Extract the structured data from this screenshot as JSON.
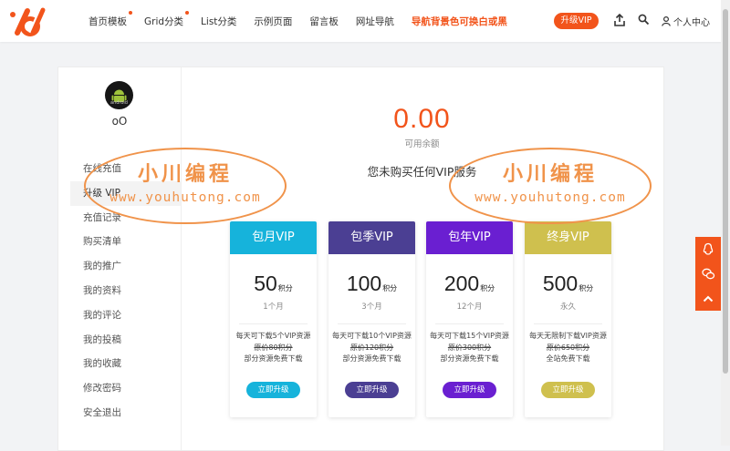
{
  "header": {
    "nav": [
      {
        "label": "首页模板",
        "dot": true,
        "hot": false
      },
      {
        "label": "Grid分类",
        "dot": true,
        "hot": false
      },
      {
        "label": "List分类",
        "dot": false,
        "hot": false
      },
      {
        "label": "示例页面",
        "dot": false,
        "hot": false
      },
      {
        "label": "留言板",
        "dot": false,
        "hot": false
      },
      {
        "label": "网址导航",
        "dot": false,
        "hot": false
      },
      {
        "label": "导航背景色可换白或黑",
        "dot": false,
        "hot": true
      }
    ],
    "upgrade_label": "升级VIP",
    "user_label": "个人中心",
    "accent": "#f2541b"
  },
  "sidebar": {
    "avatar_text": "android",
    "username": "oO",
    "menu": [
      "在线充值",
      "升级 VIP",
      "充值记录",
      "购买清单",
      "我的推广",
      "我的资料",
      "我的评论",
      "我的投稿",
      "我的收藏",
      "修改密码",
      "安全退出"
    ],
    "active_index": 1
  },
  "main": {
    "balance": "0.00",
    "balance_label": "可用余额",
    "no_vip_text": "您未购买任何VIP服务",
    "plans": [
      {
        "name": "包月VIP",
        "price": "50",
        "unit": "积分",
        "period": "1个月",
        "desc1": "每天可下载5个VIP资源",
        "orig": "原价80积分",
        "desc2": "部分资源免费下载",
        "button": "立即升级",
        "color": "#16b3db",
        "btn_color": "#16b3db"
      },
      {
        "name": "包季VIP",
        "price": "100",
        "unit": "积分",
        "period": "3个月",
        "desc1": "每天可下载10个VIP资源",
        "orig": "原价120积分",
        "desc2": "部分资源免费下载",
        "button": "立即升级",
        "color": "#4b3f93",
        "btn_color": "#4b3f93"
      },
      {
        "name": "包年VIP",
        "price": "200",
        "unit": "积分",
        "period": "12个月",
        "desc1": "每天可下载15个VIP资源",
        "orig": "原价300积分",
        "desc2": "部分资源免费下载",
        "button": "立即升级",
        "color": "#6a1fd1",
        "btn_color": "#6a1fd1"
      },
      {
        "name": "终身VIP",
        "price": "500",
        "unit": "积分",
        "period": "永久",
        "desc1": "每天无限制下载VIP资源",
        "orig": "原价650积分",
        "desc2": "全站免费下载",
        "button": "立即升级",
        "color": "#cfc04e",
        "btn_color": "#cfc04e"
      }
    ]
  },
  "watermark": {
    "cn": "小川编程",
    "url": "www.youhutong.com"
  }
}
